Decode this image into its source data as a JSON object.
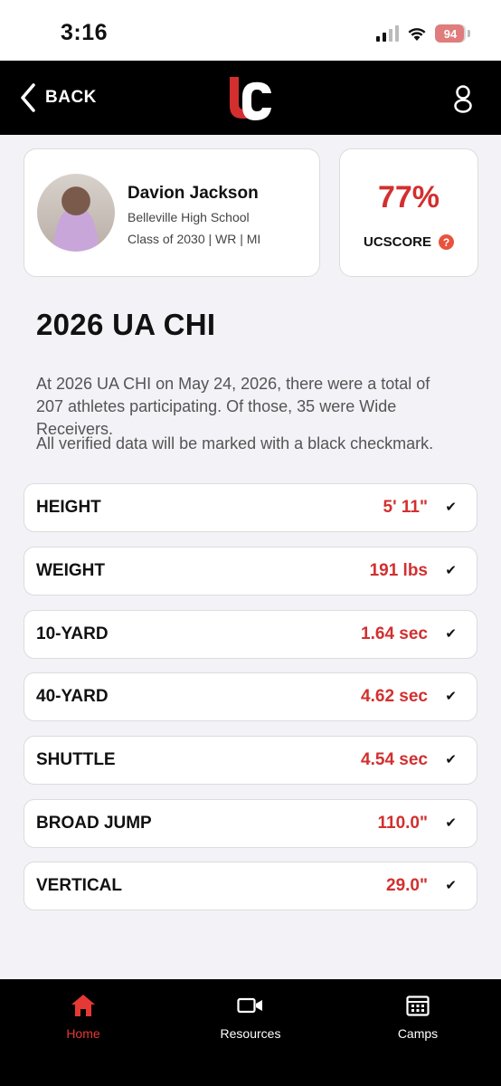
{
  "status_bar": {
    "time": "3:16",
    "battery_percent": "94",
    "battery_level": 0.94
  },
  "header": {
    "back_label": "BACK",
    "logo_text": "UC"
  },
  "athlete": {
    "name": "Davion Jackson",
    "school": "Belleville High School",
    "meta": "Class of 2030 | WR | MI"
  },
  "score": {
    "value": "77%",
    "label": "UCSCORE",
    "help_glyph": "?"
  },
  "event": {
    "title": "2026 UA CHI",
    "description": "At 2026 UA CHI on May 24, 2026, there were a total of 207 athletes participating. Of those, 35 were Wide Receivers.",
    "note": "All verified data will be marked with a black checkmark."
  },
  "metrics": [
    {
      "label": "HEIGHT",
      "value": "5' 11\"",
      "verified": "✔"
    },
    {
      "label": "WEIGHT",
      "value": "191 lbs",
      "verified": "✔"
    },
    {
      "label": "10-YARD",
      "value": "1.64 sec",
      "verified": "✔"
    },
    {
      "label": "40-YARD",
      "value": "4.62 sec",
      "verified": "✔"
    },
    {
      "label": "SHUTTLE",
      "value": "4.54 sec",
      "verified": "✔"
    },
    {
      "label": "BROAD JUMP",
      "value": "110.0\"",
      "verified": "✔"
    },
    {
      "label": "VERTICAL",
      "value": "29.0\"",
      "verified": "✔"
    }
  ],
  "bottom_nav": {
    "home_label": "Home",
    "resources_label": "Resources",
    "camps_label": "Camps"
  },
  "colors": {
    "accent": "#d32f2f",
    "header_bg": "#000000",
    "page_bg": "#f2f2f7"
  }
}
